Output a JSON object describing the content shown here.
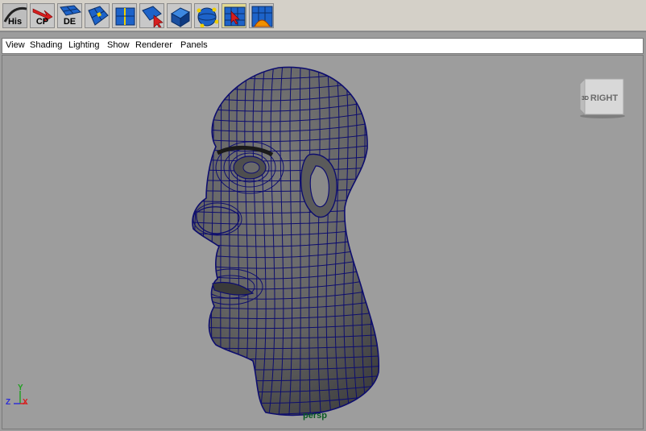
{
  "shelf": {
    "buttons": [
      {
        "name": "history-button",
        "label": "His",
        "icon": "history-curve-icon"
      },
      {
        "name": "center-pivot-button",
        "label": "CP",
        "icon": "red-arrow-icon"
      },
      {
        "name": "delete-edge-button",
        "label": "DE",
        "icon": "blue-mesh-icon"
      },
      {
        "name": "extrude-button",
        "label": "",
        "icon": "extrude-mesh-icon"
      },
      {
        "name": "split-button",
        "label": "",
        "icon": "split-mesh-icon"
      },
      {
        "name": "select-tool-button",
        "label": "",
        "icon": "mesh-select-icon"
      },
      {
        "name": "cube-button",
        "label": "",
        "icon": "poly-cube-icon"
      },
      {
        "name": "sphere-vertices-button",
        "label": "",
        "icon": "sphere-vertex-icon"
      },
      {
        "name": "move-face-button",
        "label": "",
        "icon": "mesh-cursor-icon"
      },
      {
        "name": "uv-layout-button",
        "label": "",
        "icon": "uv-mesh-icon"
      }
    ]
  },
  "menu": {
    "items": [
      "View",
      "Shading",
      "Lighting",
      "Show",
      "Renderer",
      "Panels"
    ]
  },
  "viewport": {
    "camera_label": "persp",
    "viewcube_label": "RIGHT",
    "axis": {
      "y": "Y",
      "z": "Z",
      "x": "X"
    },
    "colors": {
      "background": "#9d9d9d",
      "mesh_fill": "#616161",
      "wireframe": "#0d0d6e",
      "axis_x": "#d81c1c",
      "axis_y": "#1ea01e",
      "axis_z": "#2a2ad8"
    }
  }
}
